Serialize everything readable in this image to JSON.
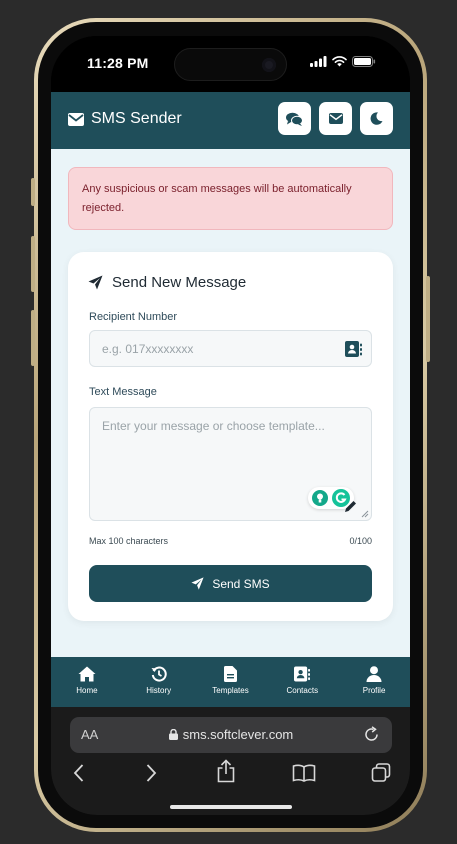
{
  "status_bar": {
    "time": "11:28 PM"
  },
  "header": {
    "title": "SMS Sender",
    "buttons": [
      "chat-icon",
      "envelope-icon",
      "moon-icon"
    ]
  },
  "alert": {
    "text": "Any suspicious or scam messages will be automatically rejected."
  },
  "form": {
    "title": "Send New Message",
    "recipient_label": "Recipient Number",
    "recipient_placeholder": "e.g. 017xxxxxxxx",
    "message_label": "Text Message",
    "message_placeholder": "Enter your message or choose template...",
    "max_hint": "Max 100 characters",
    "counter": "0/100",
    "send_label": "Send SMS"
  },
  "nav": {
    "items": [
      {
        "label": "Home",
        "icon": "home-icon"
      },
      {
        "label": "History",
        "icon": "history-icon"
      },
      {
        "label": "Templates",
        "icon": "file-icon"
      },
      {
        "label": "Contacts",
        "icon": "contacts-icon"
      },
      {
        "label": "Profile",
        "icon": "user-icon"
      }
    ]
  },
  "browser": {
    "aa_label": "AA",
    "url": "sms.softclever.com"
  },
  "colors": {
    "primary": "#1f4e5a",
    "page_bg": "#eaf4f8",
    "alert_bg": "#f9d6d9",
    "alert_text": "#7a1f2b"
  }
}
